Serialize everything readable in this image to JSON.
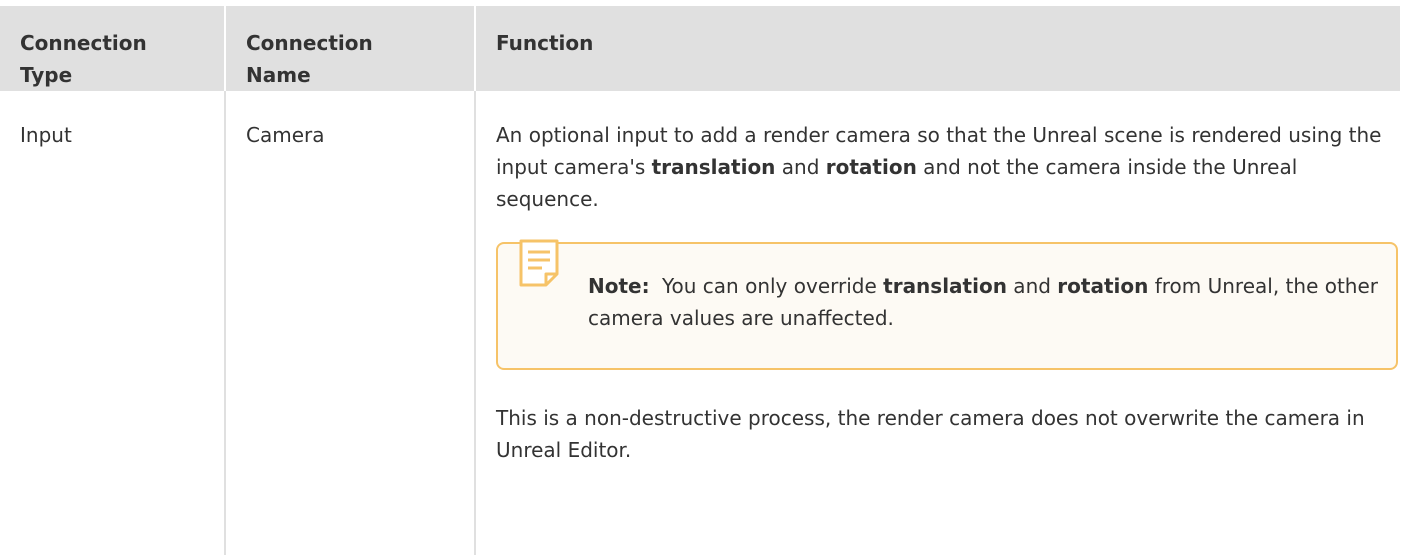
{
  "table": {
    "headers": {
      "connection_type": [
        "Connection",
        "Type"
      ],
      "connection_name": [
        "Connection",
        "Name"
      ],
      "function": "Function"
    },
    "row": {
      "connection_type": "Input",
      "connection_name": "Camera",
      "function": {
        "para1": {
          "part1": "An optional input to add a render camera so that the Unreal scene is rendered using the input camera's ",
          "bold1": "translation",
          "part2": " and ",
          "bold2": "rotation",
          "part3": " and not the camera inside the Unreal sequence."
        },
        "note": {
          "icon": "note-icon",
          "label": "Note:",
          "part1": "You can only override ",
          "bold1": "translation",
          "part2": " and ",
          "bold2": "rotation",
          "part3": " from Unreal, the other camera values are unaffected."
        },
        "para2": "This is a non-destructive process, the render camera does not overwrite the camera in Unreal Editor."
      }
    }
  },
  "colors": {
    "header_bg": "#e0e0e0",
    "text": "#333333",
    "note_border": "#f6c368",
    "note_bg": "#fdfaf4",
    "note_icon": "#f6c368"
  }
}
